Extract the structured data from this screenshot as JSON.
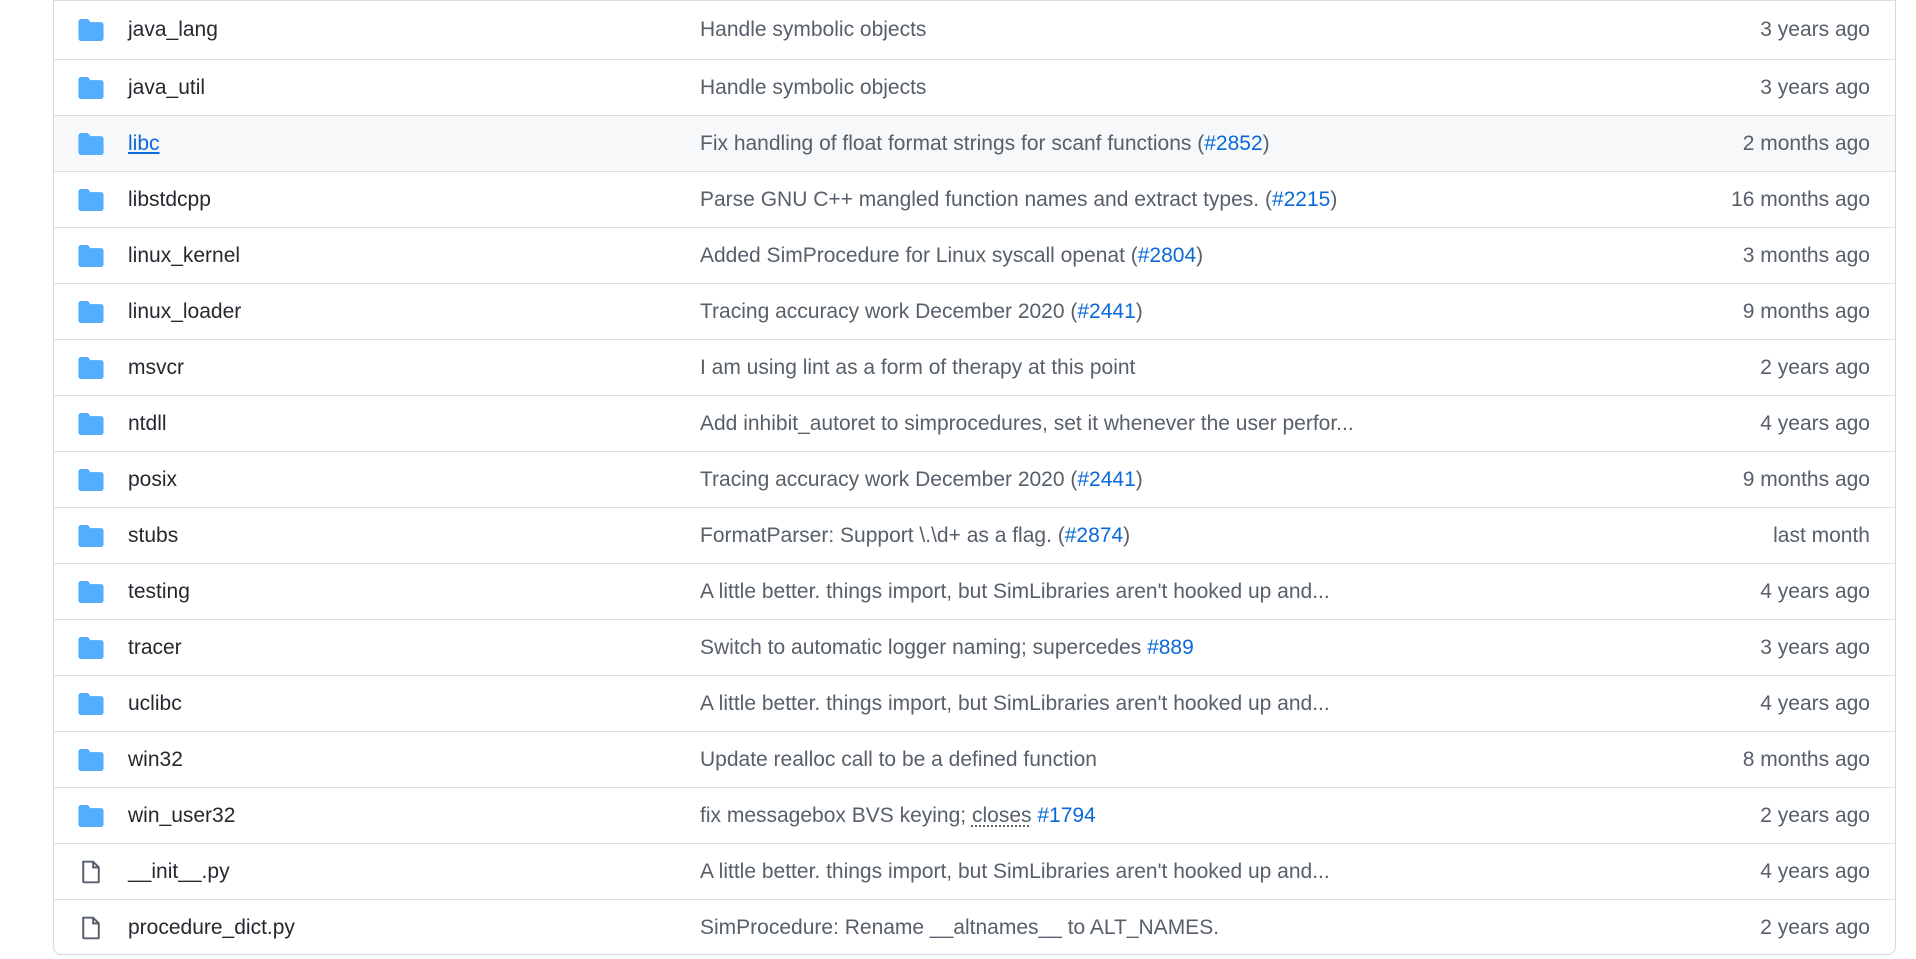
{
  "colors": {
    "folder_icon": "#54aeff",
    "file_icon": "#57606a",
    "link": "#0969da",
    "muted": "#57606a",
    "border": "#d0d7de",
    "hover_row": "#f6f8fa"
  },
  "rows": [
    {
      "type": "folder",
      "icon": "folder-icon",
      "name": "java_lang",
      "message": "Handle symbolic objects",
      "pr": "",
      "age": "3 years ago"
    },
    {
      "type": "folder",
      "icon": "folder-icon",
      "name": "java_util",
      "message": "Handle symbolic objects",
      "pr": "",
      "age": "3 years ago"
    },
    {
      "type": "folder",
      "icon": "folder-icon",
      "name": "libc",
      "message": "Fix handling of float format strings for scanf functions (",
      "pr": "#2852",
      "suffix": ")",
      "age": "2 months ago",
      "hover": true
    },
    {
      "type": "folder",
      "icon": "folder-icon",
      "name": "libstdcpp",
      "message": "Parse GNU C++ mangled function names and extract types. (",
      "pr": "#2215",
      "suffix": ")",
      "age": "16 months ago"
    },
    {
      "type": "folder",
      "icon": "folder-icon",
      "name": "linux_kernel",
      "message": "Added SimProcedure for Linux syscall openat (",
      "pr": "#2804",
      "suffix": ")",
      "age": "3 months ago"
    },
    {
      "type": "folder",
      "icon": "folder-icon",
      "name": "linux_loader",
      "message": "Tracing accuracy work December 2020 (",
      "pr": "#2441",
      "suffix": ")",
      "age": "9 months ago"
    },
    {
      "type": "folder",
      "icon": "folder-icon",
      "name": "msvcr",
      "message": "I am using lint as a form of therapy at this point",
      "pr": "",
      "age": "2 years ago"
    },
    {
      "type": "folder",
      "icon": "folder-icon",
      "name": "ntdll",
      "message": "Add inhibit_autoret to simprocedures, set it whenever the user perfor...",
      "pr": "",
      "age": "4 years ago"
    },
    {
      "type": "folder",
      "icon": "folder-icon",
      "name": "posix",
      "message": "Tracing accuracy work December 2020 (",
      "pr": "#2441",
      "suffix": ")",
      "age": "9 months ago"
    },
    {
      "type": "folder",
      "icon": "folder-icon",
      "name": "stubs",
      "message": "FormatParser: Support \\.\\d+ as a flag. (",
      "pr": "#2874",
      "suffix": ")",
      "age": "last month"
    },
    {
      "type": "folder",
      "icon": "folder-icon",
      "name": "testing",
      "message": "A little better. things import, but SimLibraries aren't hooked up and...",
      "pr": "",
      "age": "4 years ago"
    },
    {
      "type": "folder",
      "icon": "folder-icon",
      "name": "tracer",
      "message": "Switch to automatic logger naming; supercedes ",
      "pr": "#889",
      "suffix": "",
      "age": "3 years ago"
    },
    {
      "type": "folder",
      "icon": "folder-icon",
      "name": "uclibc",
      "message": "A little better. things import, but SimLibraries aren't hooked up and...",
      "pr": "",
      "age": "4 years ago"
    },
    {
      "type": "folder",
      "icon": "folder-icon",
      "name": "win32",
      "message": "Update realloc call to be a defined function",
      "pr": "",
      "age": "8 months ago"
    },
    {
      "type": "folder",
      "icon": "folder-icon",
      "name": "win_user32",
      "message": "fix messagebox BVS keying; ",
      "closes": "closes",
      "pr": "#1794",
      "suffix": "",
      "age": "2 years ago"
    },
    {
      "type": "file",
      "icon": "file-icon",
      "name": "__init__.py",
      "message": "A little better. things import, but SimLibraries aren't hooked up and...",
      "pr": "",
      "age": "4 years ago"
    },
    {
      "type": "file",
      "icon": "file-icon",
      "name": "procedure_dict.py",
      "message": "SimProcedure: Rename __altnames__ to ALT_NAMES.",
      "pr": "",
      "age": "2 years ago"
    }
  ]
}
